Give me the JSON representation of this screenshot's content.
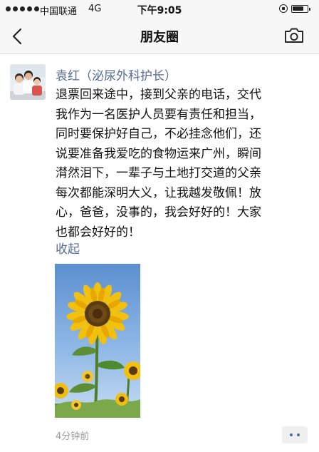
{
  "status_bar": {
    "carrier": "中国联通",
    "network": "4G",
    "time": "下午9:05",
    "battery_level": 0.85
  },
  "nav": {
    "title": "朋友圈",
    "back_icon": "chevron-left-icon",
    "camera_icon": "camera-icon"
  },
  "post": {
    "author": "袁红（泌尿外科护长）",
    "text_lines": [
      "退票回来途中，接到父亲的电话，交代",
      "我作为一名医护人员要有责任和担当，",
      "同时要保护好自己，不必挂念他们，还",
      "说要准备我爱吃的食物运来广州，瞬间",
      "潸然泪下，一辈子与土地打交道的父亲",
      "每次都能深明大义，让我越发敬佩！放",
      "心，爸爸，没事的，我会好好的！大家",
      "也都会好好的！"
    ],
    "collapse_label": "收起",
    "time_ago": "4分钟前",
    "photo_subject": "sunflower",
    "more_icon": "more-dots-icon"
  }
}
